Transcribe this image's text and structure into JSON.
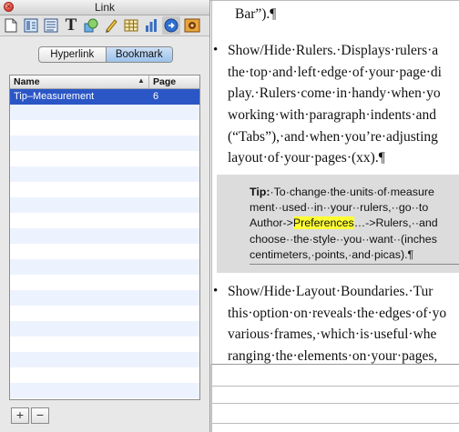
{
  "window": {
    "title": "Link"
  },
  "toolbar": {
    "tools": [
      {
        "name": "document-icon"
      },
      {
        "name": "layout-icon"
      },
      {
        "name": "text-frame-icon"
      },
      {
        "name": "text-icon",
        "glyph": "T"
      },
      {
        "name": "shapes-icon"
      },
      {
        "name": "pencil-icon"
      },
      {
        "name": "table-icon"
      },
      {
        "name": "chart-icon"
      },
      {
        "name": "link-icon"
      },
      {
        "name": "media-icon"
      }
    ]
  },
  "segmented": {
    "hyperlink": "Hyperlink",
    "bookmark": "Bookmark",
    "selected": "Bookmark"
  },
  "list": {
    "columns": {
      "name": "Name",
      "page": "Page"
    },
    "rows": [
      {
        "name": "Tip–Measurement",
        "page": "6"
      }
    ]
  },
  "buttons": {
    "add": "+",
    "remove": "−"
  },
  "document": {
    "top_line": "Bar”).¶",
    "bullet1": [
      "Show/Hide·Rulers.·Displays·rulers·a",
      "the·top·and·left·edge·of·your·page·di",
      "play.·Rulers·come·in·handy·when·yo",
      "working·with·paragraph·indents·and",
      "(“Tabs”),·and·when·you’re·adjusting",
      "layout·of·your·pages·(xx).¶"
    ],
    "tip": {
      "label": "Tip:",
      "line1": "·To·change·the·units·of·measure",
      "line2": "ment··used··in··your··rulers,··go··to",
      "line3_pre": "Author->",
      "line3_hl": "Preferences",
      "line3_post": "…->Rulers,··and",
      "line4": "choose··the·style··you··want··(inches",
      "line5": "centimeters,·points,·and·picas).¶"
    },
    "bullet2": [
      "Show/Hide·Layout·Boundaries.·Tur",
      "this·option·on·reveals·the·edges·of·yo",
      "various·frames,·which·is·useful·whe",
      "ranging·the·elements·on·your·pages,"
    ]
  }
}
